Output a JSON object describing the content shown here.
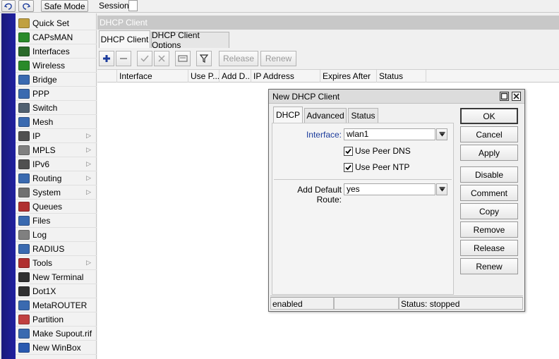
{
  "topbar": {
    "undo_icon": "undo-icon",
    "redo_icon": "redo-icon",
    "safe_mode_label": "Safe Mode",
    "session_label": "Session:"
  },
  "sidebar": {
    "items": [
      {
        "label": "Quick Set",
        "icon": "quickset-icon",
        "color": "#c0a040",
        "arrow": false
      },
      {
        "label": "CAPsMAN",
        "icon": "capsman-icon",
        "color": "#2a8a2a",
        "arrow": false
      },
      {
        "label": "Interfaces",
        "icon": "interfaces-icon",
        "color": "#2a6a2a",
        "arrow": false
      },
      {
        "label": "Wireless",
        "icon": "wireless-icon",
        "color": "#2a8a2a",
        "arrow": false
      },
      {
        "label": "Bridge",
        "icon": "bridge-icon",
        "color": "#3a6ab0",
        "arrow": false
      },
      {
        "label": "PPP",
        "icon": "ppp-icon",
        "color": "#3a6ab0",
        "arrow": false
      },
      {
        "label": "Switch",
        "icon": "switch-icon",
        "color": "#506070",
        "arrow": false
      },
      {
        "label": "Mesh",
        "icon": "mesh-icon",
        "color": "#3a6ab0",
        "arrow": false
      },
      {
        "label": "IP",
        "icon": "ip-icon",
        "color": "#505050",
        "arrow": true
      },
      {
        "label": "MPLS",
        "icon": "mpls-icon",
        "color": "#808080",
        "arrow": true
      },
      {
        "label": "IPv6",
        "icon": "ipv6-icon",
        "color": "#505050",
        "arrow": true
      },
      {
        "label": "Routing",
        "icon": "routing-icon",
        "color": "#3a6ab0",
        "arrow": true
      },
      {
        "label": "System",
        "icon": "system-icon",
        "color": "#707070",
        "arrow": true
      },
      {
        "label": "Queues",
        "icon": "queues-icon",
        "color": "#b03030",
        "arrow": false
      },
      {
        "label": "Files",
        "icon": "files-icon",
        "color": "#3a6ab0",
        "arrow": false
      },
      {
        "label": "Log",
        "icon": "log-icon",
        "color": "#808080",
        "arrow": false
      },
      {
        "label": "RADIUS",
        "icon": "radius-icon",
        "color": "#3a6ab0",
        "arrow": false
      },
      {
        "label": "Tools",
        "icon": "tools-icon",
        "color": "#b03030",
        "arrow": true
      },
      {
        "label": "New Terminal",
        "icon": "terminal-icon",
        "color": "#303030",
        "arrow": false
      },
      {
        "label": "Dot1X",
        "icon": "dot1x-icon",
        "color": "#303030",
        "arrow": false
      },
      {
        "label": "MetaROUTER",
        "icon": "metarouter-icon",
        "color": "#3a6ab0",
        "arrow": false
      },
      {
        "label": "Partition",
        "icon": "partition-icon",
        "color": "#c04040",
        "arrow": false
      },
      {
        "label": "Make Supout.rif",
        "icon": "supout-icon",
        "color": "#3a6ab0",
        "arrow": false
      },
      {
        "label": "New WinBox",
        "icon": "winbox-icon",
        "color": "#2a5ab0",
        "arrow": false
      }
    ]
  },
  "main": {
    "title": "DHCP Client",
    "tabs": [
      {
        "label": "DHCP Client"
      },
      {
        "label": "DHCP Client Options"
      }
    ],
    "toolbar": {
      "release_label": "Release",
      "renew_label": "Renew"
    },
    "columns": [
      {
        "label": "Interface"
      },
      {
        "label": "Use P..."
      },
      {
        "label": "Add D..."
      },
      {
        "label": "IP Address"
      },
      {
        "label": "Expires After"
      },
      {
        "label": "Status"
      }
    ]
  },
  "dialog": {
    "title": "New DHCP Client",
    "tabs": [
      {
        "label": "DHCP"
      },
      {
        "label": "Advanced"
      },
      {
        "label": "Status"
      }
    ],
    "interface_label": "Interface:",
    "interface_value": "wlan1",
    "use_peer_dns_label": "Use Peer DNS",
    "use_peer_ntp_label": "Use Peer NTP",
    "add_default_route_label": "Add Default Route:",
    "add_default_route_value": "yes",
    "buttons": {
      "ok": "OK",
      "cancel": "Cancel",
      "apply": "Apply",
      "disable": "Disable",
      "comment": "Comment",
      "copy": "Copy",
      "remove": "Remove",
      "release": "Release",
      "renew": "Renew"
    },
    "status": {
      "enabled": "enabled",
      "state": "Status: stopped"
    },
    "accent_color": "#1c3c9c"
  }
}
